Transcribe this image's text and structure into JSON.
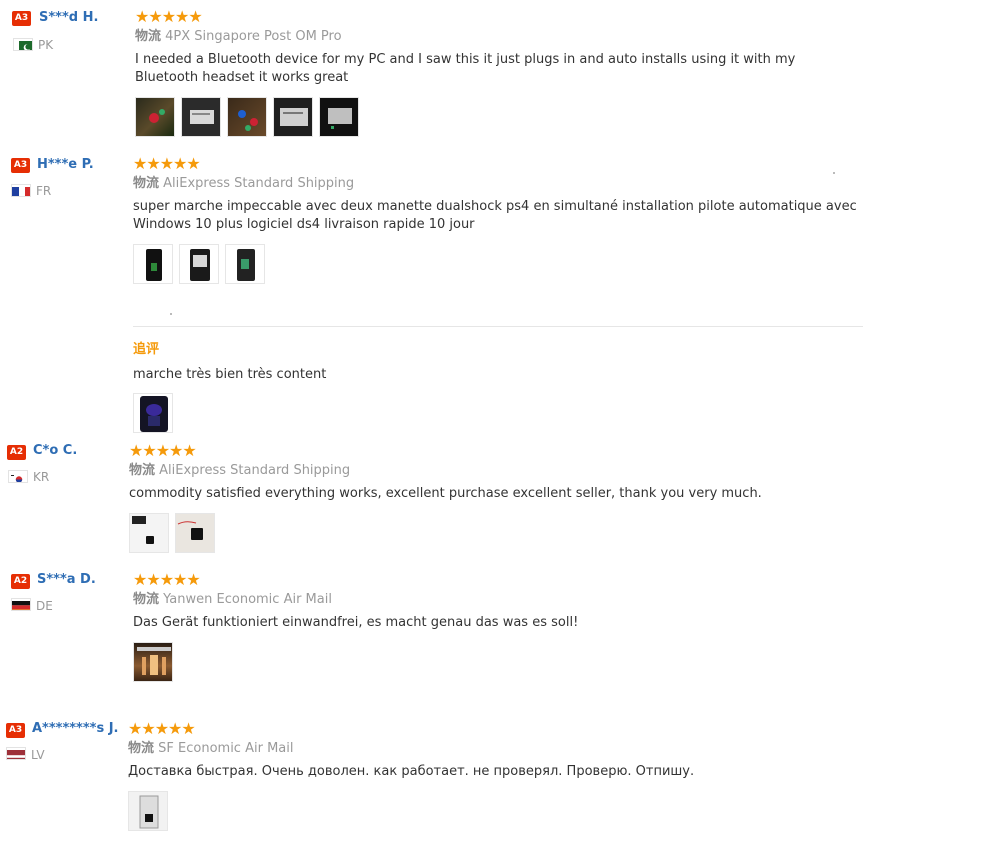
{
  "reviews": [
    {
      "level": "A3",
      "name": "S***d H.",
      "country": "PK",
      "rating": 5,
      "shipping_label": "物流",
      "shipping": "4PX Singapore Post OM Pro",
      "text": "I needed a Bluetooth device for my PC and I saw this it just plugs in and auto installs using it with my Bluetooth headset it works great",
      "photo_count": 5
    },
    {
      "level": "A3",
      "name": "H***e P.",
      "country": "FR",
      "rating": 5,
      "shipping_label": "物流",
      "shipping": "AliExpress Standard Shipping",
      "text": "super marche impeccable avec deux manette dualshock ps4 en simultané installation pilote automatique avec Windows 10 plus logiciel ds4 livraison rapide 10 jour",
      "photo_count": 3,
      "followup": {
        "label": "追评",
        "text": "marche très bien très content",
        "photo_count": 1
      }
    },
    {
      "level": "A2",
      "name": "C*o C.",
      "country": "KR",
      "rating": 5,
      "shipping_label": "物流",
      "shipping": "AliExpress Standard Shipping",
      "text": "commodity satisfied everything works, excellent purchase excellent seller, thank you very much.",
      "photo_count": 2
    },
    {
      "level": "A2",
      "name": "S***a D.",
      "country": "DE",
      "rating": 5,
      "shipping_label": "物流",
      "shipping": "Yanwen Economic Air Mail",
      "text": "Das Gerät funktioniert einwandfrei, es macht genau das was es soll!",
      "photo_count": 1
    },
    {
      "level": "A3",
      "name": "A********s J.",
      "country": "LV",
      "rating": 5,
      "shipping_label": "物流",
      "shipping": "SF Economic Air Mail",
      "text": "Доставка быстрая. Очень доволен. как работает. не проверял. Проверю. Отпишу.",
      "photo_count": 1
    }
  ],
  "stars_glyph": "★★★★★",
  "colors": {
    "accent": "#f59a0b",
    "name": "#2e6db4",
    "badge": "#e62e04"
  }
}
